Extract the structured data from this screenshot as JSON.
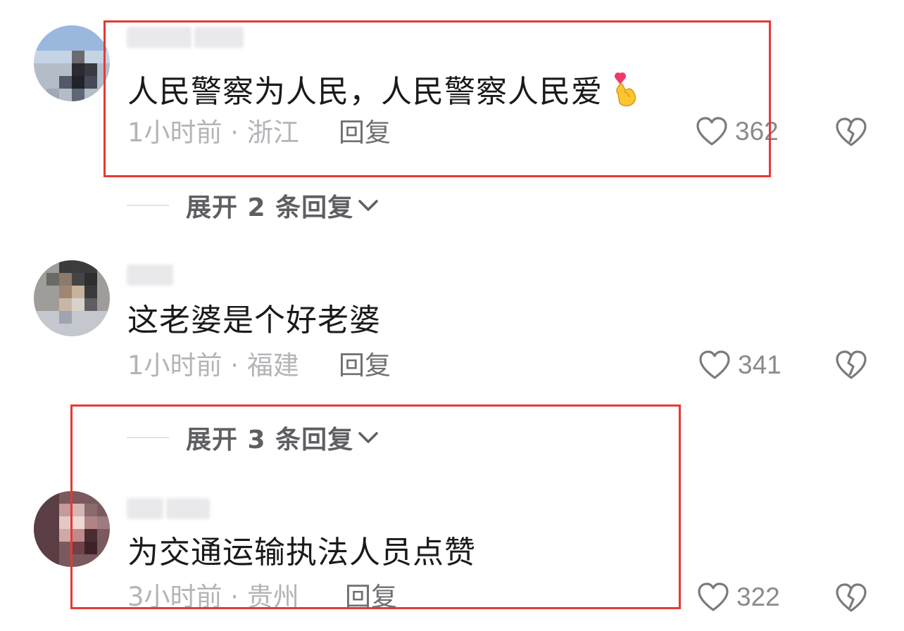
{
  "comments": [
    {
      "text": "人民警察为人民，人民警察人民爱",
      "emoji": "finger-heart-emoji",
      "time_location": "1小时前 · 浙江",
      "reply_label": "回复",
      "likes": "362",
      "expand_label": "展开 2 条回复"
    },
    {
      "text": "这老婆是个好老婆",
      "time_location": "1小时前 · 福建",
      "reply_label": "回复",
      "likes": "341",
      "expand_label": "展开 3 条回复"
    },
    {
      "text": "为交通运输执法人员点赞",
      "time_location": "3小时前 · 贵州",
      "reply_label": "回复",
      "likes": "322"
    }
  ],
  "colors": {
    "highlight_box": "#e53935",
    "comment_text": "#1a1a1a",
    "meta_text": "#b4b4b8",
    "reply_text": "#6f6f73",
    "icon_stroke": "#7a7a7e"
  }
}
